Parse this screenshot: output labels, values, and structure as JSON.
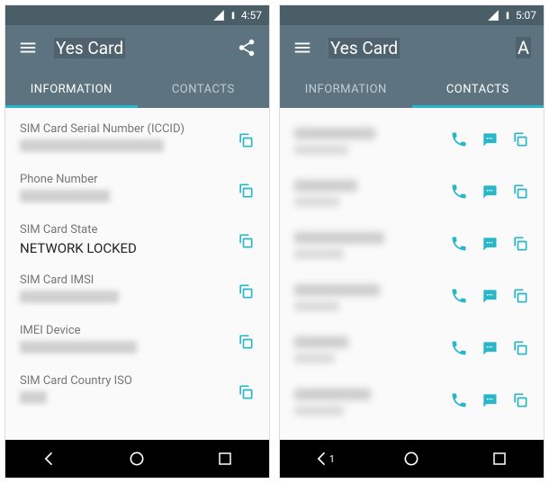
{
  "left": {
    "status_time": "4:57",
    "app_title": "Yes Card",
    "action_letter": "",
    "tabs": {
      "info": "INFORMATION",
      "contacts": "CONTACTS"
    },
    "active_tab": "info",
    "info_items": [
      {
        "label": "SIM Card Serial Number (ICCID)",
        "value": "",
        "blurred": true,
        "blur_w": 160
      },
      {
        "label": "Phone Number",
        "value": "",
        "blurred": true,
        "blur_w": 100
      },
      {
        "label": "SIM Card State",
        "value": "NETWORK LOCKED",
        "blurred": false
      },
      {
        "label": "SIM Card IMSI",
        "value": "",
        "blurred": true,
        "blur_w": 110
      },
      {
        "label": "IMEI Device",
        "value": "",
        "blurred": true,
        "blur_w": 130
      },
      {
        "label": "SIM Card Country ISO",
        "value": "",
        "blurred": true,
        "blur_w": 30
      }
    ]
  },
  "right": {
    "status_time": "5:07",
    "app_title": "Yes Card",
    "action_letter": "A",
    "tabs": {
      "info": "INFORMATION",
      "contacts": "CONTACTS"
    },
    "active_tab": "contacts",
    "contacts": [
      {
        "name_w": 90,
        "sub_w": 60
      },
      {
        "name_w": 70,
        "sub_w": 50
      },
      {
        "name_w": 100,
        "sub_w": 55
      },
      {
        "name_w": 95,
        "sub_w": 50
      },
      {
        "name_w": 60,
        "sub_w": 45
      },
      {
        "name_w": 85,
        "sub_w": 55
      }
    ]
  },
  "icons": {
    "menu": "menu-icon",
    "share": "share-icon",
    "copy": "copy-icon",
    "call": "call-icon",
    "sms": "sms-icon"
  }
}
